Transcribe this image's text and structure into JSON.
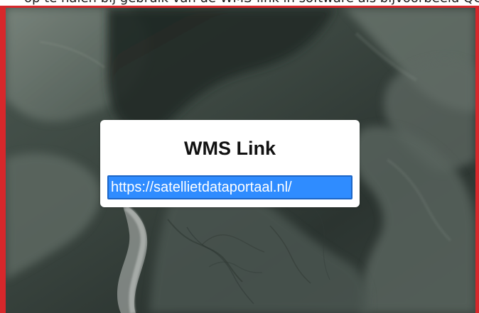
{
  "header": {
    "partial_text": "op te halen bij gebruik van de WMS-link in software als bijvoorbeeld QGIS"
  },
  "dialog": {
    "title": "WMS Link",
    "link_value": "https://satellietdataportaal.nl/"
  },
  "colors": {
    "frame_border": "#d7272b",
    "card_background": "#ffffff",
    "selection_background": "#2f8cff",
    "selection_text": "#ffffff",
    "title_text": "#111111"
  },
  "icons": {
    "map_preview": "satellite-image"
  }
}
